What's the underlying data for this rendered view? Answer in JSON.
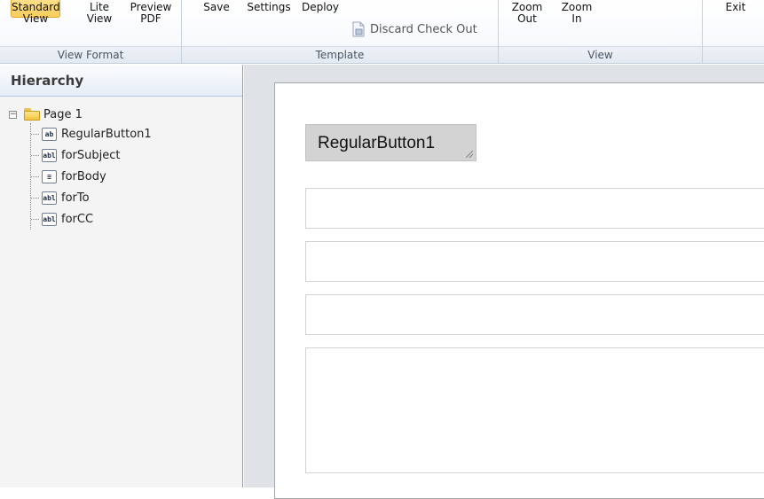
{
  "ribbon": {
    "view_format": {
      "label": "View Format",
      "buttons": [
        {
          "line1": "Standard",
          "line2": "View"
        },
        {
          "line1": "Lite",
          "line2": "View"
        },
        {
          "line1": "Preview",
          "line2": "PDF"
        }
      ]
    },
    "template": {
      "label": "Template",
      "save": "Save",
      "settings": "Settings",
      "deploy": "Deploy",
      "discard": "Discard Check Out"
    },
    "view": {
      "label": "View",
      "zoom_out": {
        "line1": "Zoom",
        "line2": "Out"
      },
      "zoom_in": {
        "line1": "Zoom",
        "line2": "In"
      }
    },
    "exit": "Exit"
  },
  "hierarchy": {
    "title": "Hierarchy",
    "root": "Page 1",
    "items": [
      {
        "icon": "ab",
        "label": "RegularButton1"
      },
      {
        "icon": "abl",
        "label": "forSubject"
      },
      {
        "icon": "list",
        "label": "forBody"
      },
      {
        "icon": "abl",
        "label": "forTo"
      },
      {
        "icon": "abl",
        "label": "forCC"
      }
    ]
  },
  "canvas": {
    "button_label": "RegularButton1"
  },
  "colors": {
    "active_button": "#f8cd5b",
    "panel_border": "#7da2ce",
    "canvas_bg": "#dfe3e8"
  }
}
